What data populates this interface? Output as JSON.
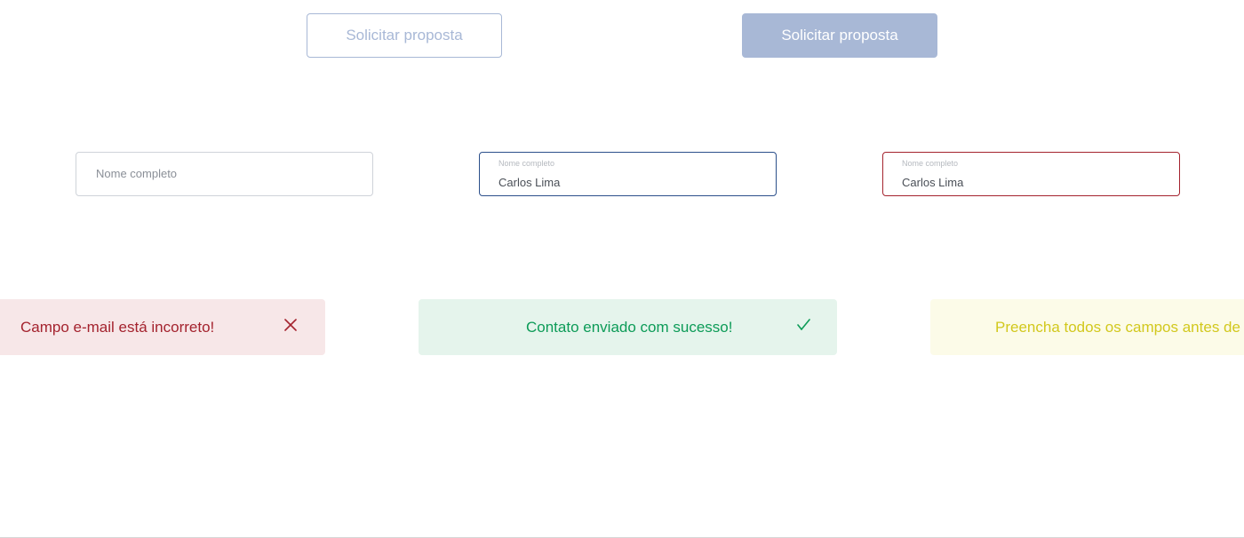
{
  "buttons": {
    "outline_label": "Solicitar proposta",
    "filled_label": "Solicitar proposta"
  },
  "inputs": {
    "default": {
      "placeholder": "Nome completo"
    },
    "focus": {
      "label": "Nome completo",
      "value": "Carlos Lima"
    },
    "error": {
      "label": "Nome completo",
      "value": "Carlos Lima"
    }
  },
  "toasts": {
    "error": {
      "text": "Campo e-mail está incorreto!",
      "icon": "close-icon",
      "color": "#a4232e"
    },
    "success": {
      "text": "Contato enviado com sucesso!",
      "icon": "check-icon",
      "color": "#0c9b57"
    },
    "warning": {
      "text": "Preencha todos os campos antes de enviar!",
      "color": "#d2c81d"
    }
  },
  "colors": {
    "primary_disabled": "#a8b8d6",
    "focus_border": "#2b4f8a",
    "error_border": "#a4232e"
  }
}
